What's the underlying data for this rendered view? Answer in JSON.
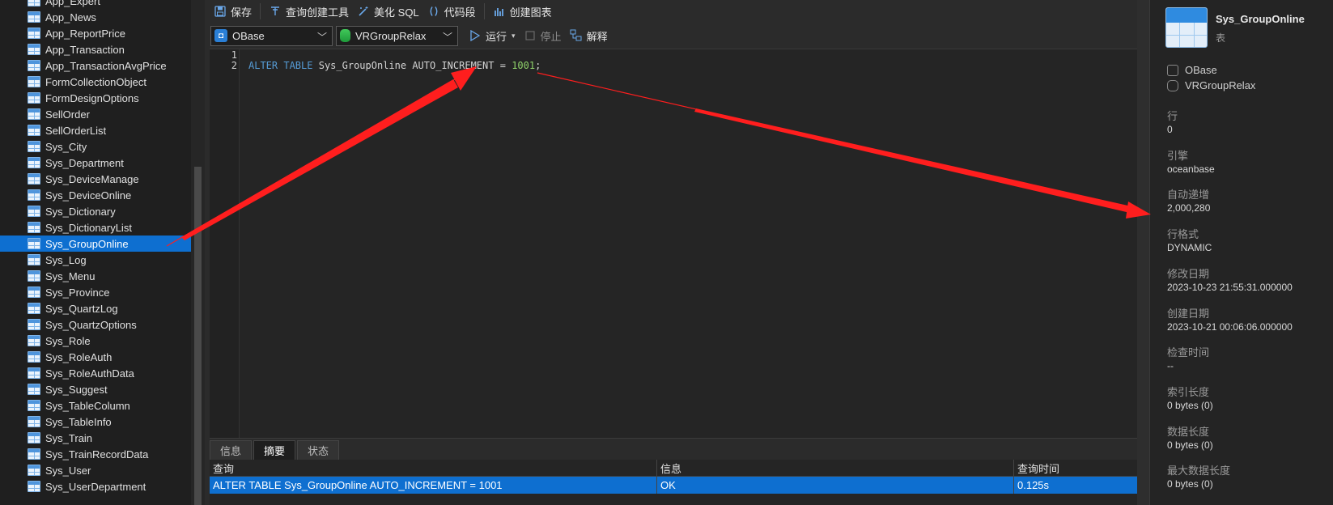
{
  "tree": {
    "items": [
      {
        "label": "App_Expert",
        "selected": false
      },
      {
        "label": "App_News",
        "selected": false
      },
      {
        "label": "App_ReportPrice",
        "selected": false
      },
      {
        "label": "App_Transaction",
        "selected": false
      },
      {
        "label": "App_TransactionAvgPrice",
        "selected": false
      },
      {
        "label": "FormCollectionObject",
        "selected": false
      },
      {
        "label": "FormDesignOptions",
        "selected": false
      },
      {
        "label": "SellOrder",
        "selected": false
      },
      {
        "label": "SellOrderList",
        "selected": false
      },
      {
        "label": "Sys_City",
        "selected": false
      },
      {
        "label": "Sys_Department",
        "selected": false
      },
      {
        "label": "Sys_DeviceManage",
        "selected": false
      },
      {
        "label": "Sys_DeviceOnline",
        "selected": false
      },
      {
        "label": "Sys_Dictionary",
        "selected": false
      },
      {
        "label": "Sys_DictionaryList",
        "selected": false
      },
      {
        "label": "Sys_GroupOnline",
        "selected": true
      },
      {
        "label": "Sys_Log",
        "selected": false
      },
      {
        "label": "Sys_Menu",
        "selected": false
      },
      {
        "label": "Sys_Province",
        "selected": false
      },
      {
        "label": "Sys_QuartzLog",
        "selected": false
      },
      {
        "label": "Sys_QuartzOptions",
        "selected": false
      },
      {
        "label": "Sys_Role",
        "selected": false
      },
      {
        "label": "Sys_RoleAuth",
        "selected": false
      },
      {
        "label": "Sys_RoleAuthData",
        "selected": false
      },
      {
        "label": "Sys_Suggest",
        "selected": false
      },
      {
        "label": "Sys_TableColumn",
        "selected": false
      },
      {
        "label": "Sys_TableInfo",
        "selected": false
      },
      {
        "label": "Sys_Train",
        "selected": false
      },
      {
        "label": "Sys_TrainRecordData",
        "selected": false
      },
      {
        "label": "Sys_User",
        "selected": false
      },
      {
        "label": "Sys_UserDepartment",
        "selected": false
      }
    ]
  },
  "toolbar": {
    "save": "保存",
    "query_builder": "查询创建工具",
    "beautify_sql": "美化 SQL",
    "code_snippet": "代码段",
    "create_chart": "创建图表",
    "connection": "OBase",
    "database": "VRGroupRelax",
    "run": "运行",
    "stop": "停止",
    "explain": "解释"
  },
  "editor": {
    "line_numbers": [
      "1",
      "2"
    ],
    "line2_kw": "ALTER TABLE",
    "line2_table": "Sys_GroupOnline",
    "line2_col": "AUTO_INCREMENT",
    "line2_eq": "=",
    "line2_num": "1001",
    "line2_semi": ";"
  },
  "bottom": {
    "tabs": [
      {
        "label": "信息",
        "active": false
      },
      {
        "label": "摘要",
        "active": true
      },
      {
        "label": "状态",
        "active": false
      }
    ],
    "columns": [
      "查询",
      "信息",
      "查询时间"
    ],
    "rows": [
      {
        "query": "ALTER TABLE Sys_GroupOnline AUTO_INCREMENT = 1001",
        "info": "OK",
        "time": "0.125s"
      }
    ]
  },
  "info": {
    "title": "Sys_GroupOnline",
    "subtitle": "表",
    "connection": "OBase",
    "database": "VRGroupRelax",
    "props": [
      {
        "label": "行",
        "value": "0"
      },
      {
        "label": "引擎",
        "value": "oceanbase"
      },
      {
        "label": "自动递增",
        "value": "2,000,280"
      },
      {
        "label": "行格式",
        "value": "DYNAMIC"
      },
      {
        "label": "修改日期",
        "value": "2023-10-23 21:55:31.000000"
      },
      {
        "label": "创建日期",
        "value": "2023-10-21 00:06:06.000000"
      },
      {
        "label": "检查时间",
        "value": "--"
      },
      {
        "label": "索引长度",
        "value": "0 bytes (0)"
      },
      {
        "label": "数据长度",
        "value": "0 bytes (0)"
      },
      {
        "label": "最大数据长度",
        "value": "0 bytes (0)"
      }
    ]
  },
  "colors": {
    "selection": "#0e6fd0",
    "annotation_arrow": "#ff1e1e",
    "keyword": "#569cd6",
    "number": "#8fd16a"
  }
}
